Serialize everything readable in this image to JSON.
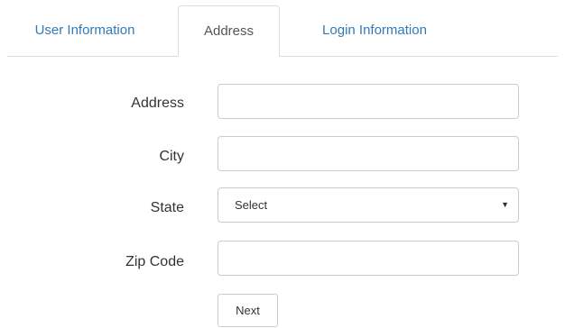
{
  "tabs": [
    {
      "label": "User Information"
    },
    {
      "label": "Address"
    },
    {
      "label": "Login Information"
    }
  ],
  "form": {
    "address": {
      "label": "Address",
      "value": ""
    },
    "city": {
      "label": "City",
      "value": ""
    },
    "state": {
      "label": "State",
      "selected": "Select"
    },
    "zip": {
      "label": "Zip Code",
      "value": ""
    },
    "next_label": "Next"
  },
  "colors": {
    "tab_link": "#337ab7",
    "tab_active_text": "#555555",
    "border": "#cccccc"
  },
  "icons": {
    "state_caret": "chevron-down-icon"
  }
}
